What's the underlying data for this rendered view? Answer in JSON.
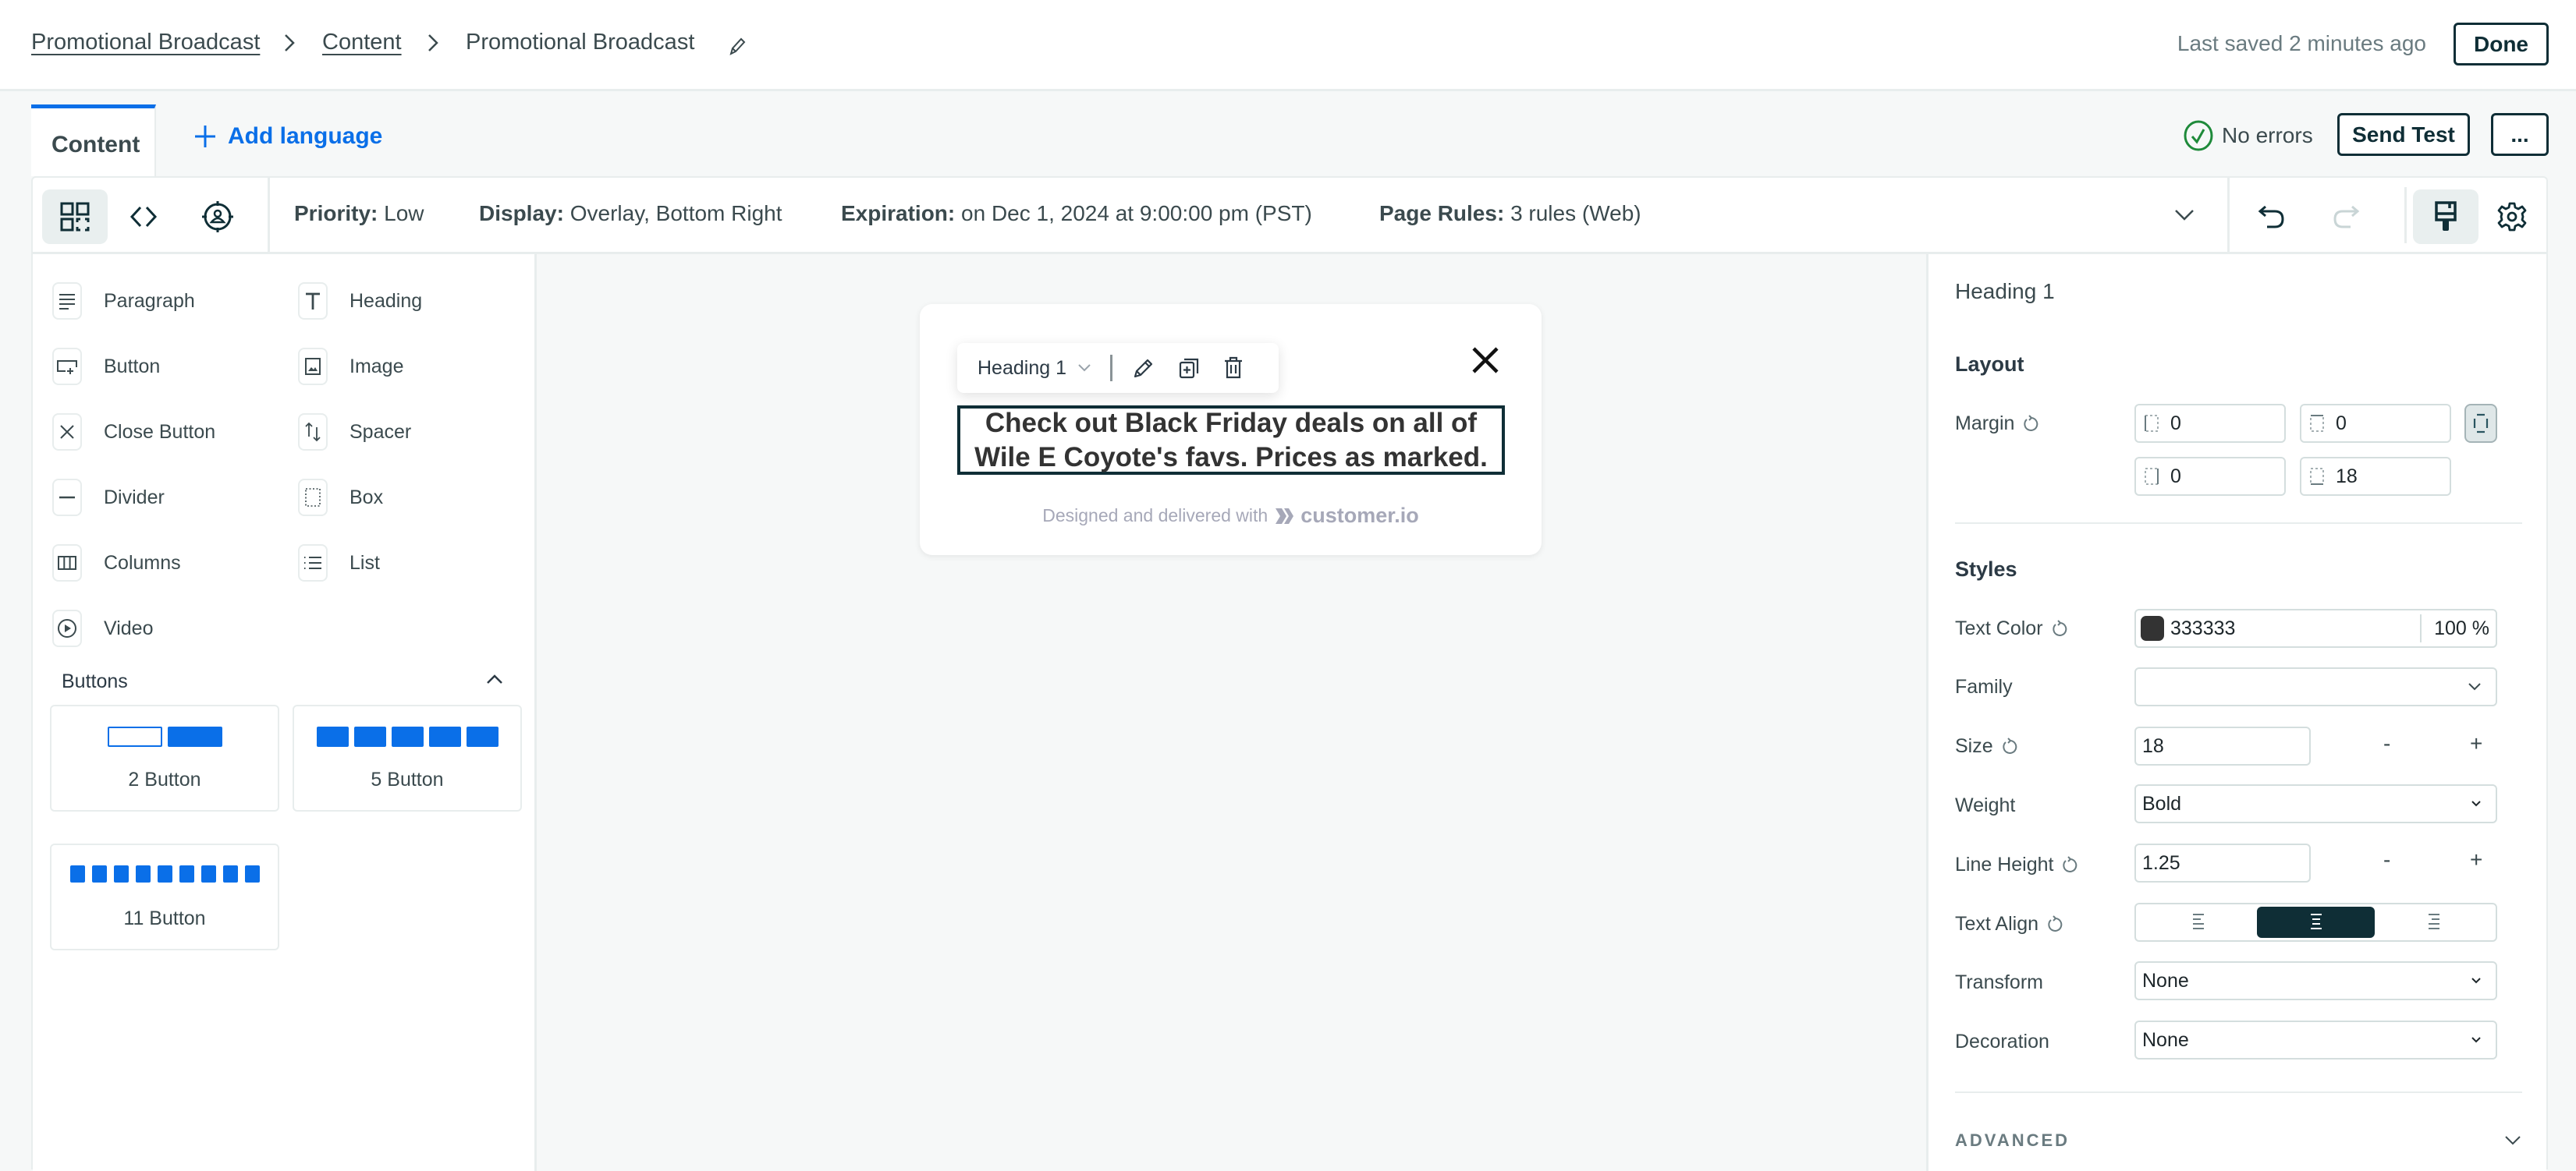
{
  "header": {
    "breadcrumb": [
      {
        "label": "Promotional Broadcast",
        "link": true
      },
      {
        "label": "Content",
        "link": true
      },
      {
        "label": "Promotional Broadcast",
        "link": false
      }
    ],
    "edit_icon": "pencil-icon",
    "last_saved": "Last saved 2 minutes ago",
    "done_label": "Done"
  },
  "tabs": {
    "content_label": "Content",
    "add_language_label": "Add language",
    "status_text": "No errors",
    "send_test_label": "Send Test",
    "more_label": "..."
  },
  "toolbar": {
    "view_icons": [
      "visual-editor-icon",
      "code-icon",
      "targeting-icon"
    ],
    "priority_label": "Priority:",
    "priority_value": "Low",
    "display_label": "Display:",
    "display_value": "Overlay, Bottom Right",
    "expiration_label": "Expiration:",
    "expiration_value": "on Dec 1, 2024 at 9:00:00 pm (PST)",
    "page_rules_label": "Page Rules:",
    "page_rules_value": "3 rules (Web)",
    "right_icons": [
      "chevron-down-icon",
      "undo-icon",
      "redo-icon",
      "paint-brush-icon",
      "gear-icon"
    ]
  },
  "elements": [
    {
      "label": "Paragraph",
      "icon": "paragraph-icon"
    },
    {
      "label": "Heading",
      "icon": "heading-icon"
    },
    {
      "label": "Button",
      "icon": "button-icon"
    },
    {
      "label": "Image",
      "icon": "image-icon"
    },
    {
      "label": "Close Button",
      "icon": "close-icon"
    },
    {
      "label": "Spacer",
      "icon": "spacer-icon"
    },
    {
      "label": "Divider",
      "icon": "divider-icon"
    },
    {
      "label": "Box",
      "icon": "box-icon"
    },
    {
      "label": "Columns",
      "icon": "columns-icon"
    },
    {
      "label": "List",
      "icon": "list-icon"
    },
    {
      "label": "Video",
      "icon": "video-icon"
    }
  ],
  "buttons_section": {
    "title": "Buttons",
    "cards": [
      {
        "label": "2 Button"
      },
      {
        "label": "5 Button"
      },
      {
        "label": "11 Button"
      }
    ]
  },
  "canvas": {
    "block_type": "Heading 1",
    "heading_text": "Check out Black Friday deals on all of Wile E Coyote's favs. Prices as marked.",
    "footer_text": "Designed and delivered with",
    "brand": "customer.io"
  },
  "properties": {
    "title": "Heading 1",
    "layout_title": "Layout",
    "margin_label": "Margin",
    "margin": {
      "left": "0",
      "top": "0",
      "right": "0",
      "bottom": "18"
    },
    "styles_title": "Styles",
    "text_color_label": "Text Color",
    "text_color_value": "333333",
    "text_color_swatch": "#333333",
    "text_color_opacity": "100 %",
    "family_label": "Family",
    "family_value": "",
    "size_label": "Size",
    "size_value": "18",
    "weight_label": "Weight",
    "weight_value": "Bold",
    "line_height_label": "Line Height",
    "line_height_value": "1.25",
    "text_align_label": "Text Align",
    "text_align_value": "center",
    "transform_label": "Transform",
    "transform_value": "None",
    "decoration_label": "Decoration",
    "decoration_value": "None",
    "advanced_label": "ADVANCED",
    "minus": "-",
    "plus": "+"
  },
  "colors": {
    "accent": "#0a6fe8",
    "dark": "#0f2e36",
    "success": "#1e8a3a"
  }
}
